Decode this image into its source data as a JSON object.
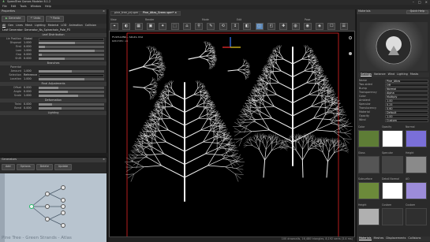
{
  "app": {
    "title": "SpeedTree Games Modeler 8.1.2"
  },
  "menu": [
    "File",
    "Edit",
    "Tools",
    "Window",
    "Help"
  ],
  "window_controls": [
    "–",
    "□",
    "×"
  ],
  "left": {
    "title": "Properties",
    "buttons": [
      "Generate",
      "Undo",
      "Redo"
    ],
    "tabs": [
      "All",
      "Gen",
      "Lines",
      "Mesh",
      "Lighting",
      "Material",
      "LOD",
      "Animation",
      "Collision"
    ],
    "breadcrumb": "Leaf Generator: Generator_Ns_Spinechain_Pole_P3",
    "sections": {
      "s1": "Leaf Distribution",
      "s2": "Branches",
      "s3": "Final Adjustments",
      "s4": "Deformation",
      "s5": "Lighting"
    },
    "rows1": [
      {
        "label": "Lie Position",
        "val": "Global",
        "type": "field"
      },
      {
        "label": "Disposal",
        "val": "1.000",
        "fill": 55
      },
      {
        "label": "First",
        "val": "0.000",
        "fill": 10
      },
      {
        "label": "Last",
        "val": "1.000",
        "fill": 85
      },
      {
        "label": "Gap",
        "val": "0.000",
        "fill": 5
      },
      {
        "label": "Shift",
        "val": "0.000",
        "fill": 40
      }
    ],
    "rows2": [
      {
        "label": "Parental",
        "val": "",
        "type": "head"
      },
      {
        "label": "Amount",
        "val": "1.000",
        "fill": 50
      },
      {
        "label": "Selection",
        "val": "Reference",
        "type": "field"
      },
      {
        "label": "Location",
        "val": "1.000",
        "fill": 70
      }
    ],
    "rows3": [
      {
        "label": "Offset",
        "val": "0.000",
        "fill": 30
      },
      {
        "label": "Angle",
        "val": "0.000",
        "fill": 45
      },
      {
        "label": "Scale",
        "val": "1.000",
        "fill": 60
      }
    ],
    "rows4": [
      {
        "label": "Twist",
        "val": "0.000",
        "fill": 20
      },
      {
        "label": "Bend",
        "val": "0.000",
        "fill": 35
      }
    ]
  },
  "generators": {
    "title": "Generators",
    "buttons": [
      "Add",
      "Options",
      "Delete",
      "Update"
    ],
    "label": "Pine Tree - Green Strands - Atlas",
    "nodes": [
      "Trunk",
      "Branch",
      "Branch",
      "Branch",
      "Leaf",
      "Leaf",
      "Leaf",
      "Leaf",
      "Leaf"
    ]
  },
  "center": {
    "doc_tabs": [
      "pine_tree_prj.spm",
      "Pine_Atlas_Green.spm*"
    ],
    "groups": [
      "View",
      "Render",
      "Mode",
      "Edit",
      "Pose"
    ],
    "tools": [
      "⌖",
      "◐",
      "▦",
      "▣",
      "✦",
      "⬚",
      "⌂",
      "⚲",
      "✎",
      "⟲",
      "↕",
      "◧",
      "◫",
      "◰",
      "✚",
      "◍",
      "◉",
      "◈",
      "☐",
      "☰"
    ],
    "viewport_label": "POLYGONS - SELECTED",
    "viewport_sub": "Batches: 18",
    "status": "100 drawcalls, 16,480 triangles, 8,192 verts (3.4 ms)"
  },
  "right": {
    "title": "Materials",
    "quick_help": "Quick Help",
    "panel_tabs": [
      "Settings",
      "Variance",
      "Wind",
      "Lighting",
      "Masks"
    ],
    "fields": [
      {
        "label": "Name",
        "value": "Pine_Atlas"
      },
      {
        "label": "Two-sided",
        "value": "Off"
      },
      {
        "label": "Bump",
        "value": "Normal"
      },
      {
        "label": "Transparency",
        "value": "Alpha"
      },
      {
        "label": "Color",
        "value": "Multiply"
      },
      {
        "label": "Ambient",
        "value": "1.00"
      },
      {
        "label": "Specular",
        "value": "0.25"
      },
      {
        "label": "Translucency",
        "value": "0.60"
      },
      {
        "label": "Material",
        "value": "Default"
      },
      {
        "label": "Opacity",
        "value": "1.00"
      },
      {
        "label": "Wind",
        "value": "Custom"
      }
    ],
    "maps": [
      "Color",
      "Opacity",
      "Normal",
      "Gloss",
      "Specular",
      "Height",
      "Subsurface",
      "Detail Normal",
      "AO",
      "Height",
      "Custom",
      "Custom"
    ],
    "map_colors": [
      "#5e7d36",
      "#ffffff",
      "#7a6fd8",
      "#555555",
      "#444444",
      "#8a8a8a",
      "#6c8a3a",
      "#ffffff",
      "#9c8cd9",
      "#b0b0b0",
      "#333333",
      "#2f2f2f"
    ],
    "bottom_tabs": [
      "Materials",
      "Meshes",
      "Displacements",
      "Collisions"
    ]
  },
  "colors": {
    "accent": "#5b87b8",
    "frame": "#ff2222"
  }
}
